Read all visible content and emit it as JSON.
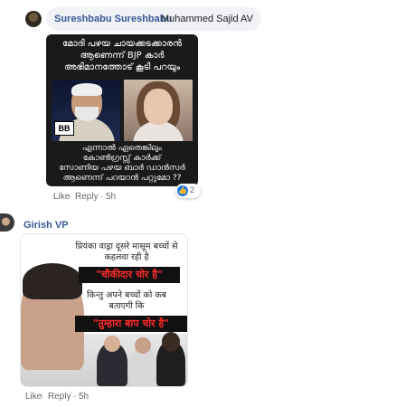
{
  "comment1": {
    "author": "Sureshbabu Sureshbabu",
    "mention": "Muhammed Sajid AV",
    "meme": {
      "top_lines": [
        "മോദി പഴയ ചായക്കടക്കാരൻ",
        "ആണെന്ന് BJP കാർ",
        "അഭിമാനത്തോട് കൂടി പറയും"
      ],
      "badge": "BB",
      "bottom_lines": [
        "എന്നാൽ ഏതെങ്കിലും",
        "കോൺഗ്രസ്സ് കാർക്ക്",
        "സോണിയ പഴയ ബാർ ഡാൻസർ",
        "ആണെന്ന് പറയാൻ പറ്റുമോ ??"
      ]
    },
    "actions": {
      "like": "Like",
      "reply": "Reply",
      "separator": "·",
      "time": "5h"
    },
    "reaction_count": "2",
    "reaction_icon": "like-icon"
  },
  "comment2": {
    "author": "Girish VP",
    "meme": {
      "line1": "प्रियंका वाड्रा दूसरे मासूम बच्चों से",
      "line2": "कहलवा रही है",
      "banner1": "\"चौकीदार चोर है\"",
      "line3": "किन्तु अपने बच्चों को कब",
      "line4": "बताएगी कि",
      "banner2": "\"तुम्हारा बाप चोर है\""
    },
    "actions": {
      "like": "Like",
      "reply": "Reply",
      "separator": "·",
      "time": "5h"
    }
  },
  "colors": {
    "author_link": "#385898",
    "meta_text": "#65676b",
    "bubble_bg": "#f0f2f5",
    "like_blue": "#1877f2",
    "banner_red": "#ff2a2a"
  }
}
